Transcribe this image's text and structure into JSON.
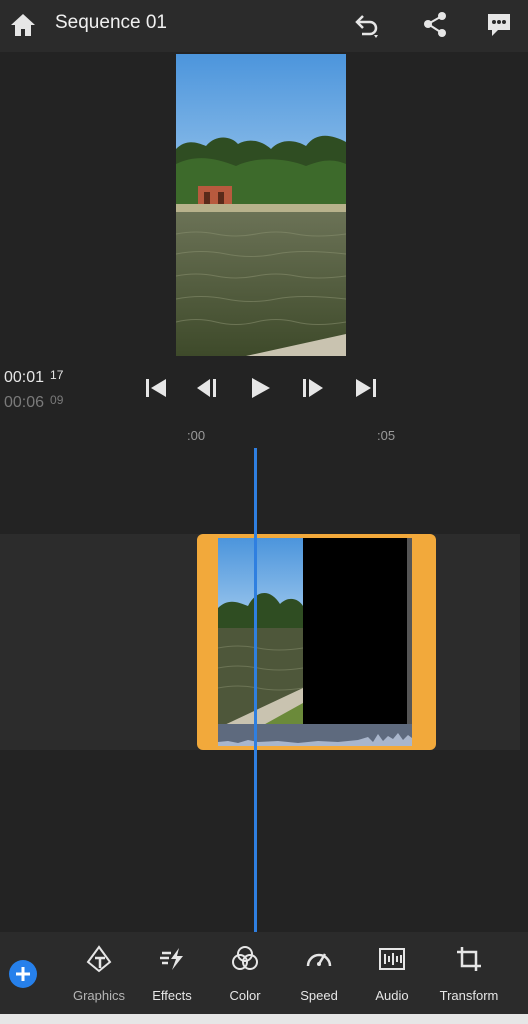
{
  "header": {
    "title": "Sequence 01",
    "icons": [
      "home-icon",
      "undo-icon",
      "share-icon",
      "comment-icon"
    ]
  },
  "preview": {
    "description_colors": {
      "sky": "#5aa2e0",
      "water": "#51573a",
      "trees": "#3a5b2c"
    }
  },
  "timecode": {
    "current": "00:01",
    "current_frames": "17",
    "total": "00:06",
    "total_frames": "09"
  },
  "transport": {
    "icons": [
      "skip-to-start-icon",
      "step-back-icon",
      "play-icon",
      "step-forward-icon",
      "skip-to-end-icon"
    ]
  },
  "ruler": {
    "labels": [
      ":00",
      ":05"
    ]
  },
  "colors": {
    "accent": "#2680eb",
    "clip_border": "#f2a93b",
    "playhead": "#2f7fe0",
    "background": "#232323"
  },
  "toolbar": {
    "add_icon": "plus-icon",
    "tools": [
      {
        "label": "Graphics",
        "icon": "graphics-icon"
      },
      {
        "label": "Effects",
        "icon": "effects-icon"
      },
      {
        "label": "Color",
        "icon": "color-icon"
      },
      {
        "label": "Speed",
        "icon": "speed-icon"
      },
      {
        "label": "Audio",
        "icon": "audio-icon"
      },
      {
        "label": "Transform",
        "icon": "transform-icon"
      }
    ]
  }
}
